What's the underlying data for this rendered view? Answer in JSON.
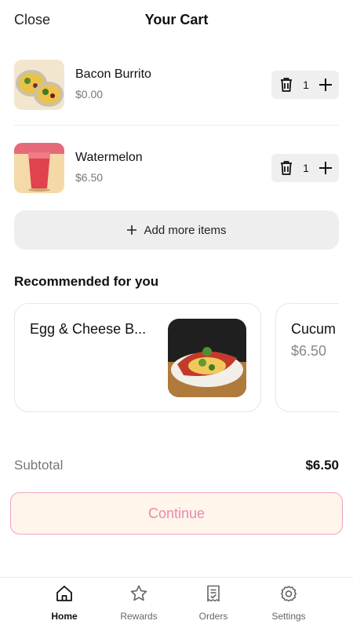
{
  "header": {
    "close_label": "Close",
    "title": "Your Cart"
  },
  "cart": {
    "items": [
      {
        "name": "Bacon Burrito",
        "price": "$0.00",
        "quantity": "1",
        "image_icon": "burrito-photo"
      },
      {
        "name": "Watermelon",
        "price": "$6.50",
        "quantity": "1",
        "image_icon": "watermelon-drink-photo"
      }
    ],
    "add_more_label": "Add more items"
  },
  "recommended": {
    "title": "Recommended for you",
    "items": [
      {
        "name": "Egg & Cheese B...",
        "price": "",
        "image_icon": "egg-cheese-burrito-photo"
      },
      {
        "name": "Cucum",
        "price": "$6.50"
      }
    ]
  },
  "summary": {
    "subtotal_label": "Subtotal",
    "subtotal_value": "$6.50"
  },
  "continue_label": "Continue",
  "nav": {
    "items": [
      {
        "label": "Home",
        "icon": "home-icon",
        "active": true
      },
      {
        "label": "Rewards",
        "icon": "star-icon",
        "active": false
      },
      {
        "label": "Orders",
        "icon": "receipt-icon",
        "active": false
      },
      {
        "label": "Settings",
        "icon": "gear-icon",
        "active": false
      }
    ]
  },
  "colors": {
    "accent_pink": "#e889b2",
    "continue_bg": "#fff5ea",
    "border_pink": "#f0a3c2"
  }
}
